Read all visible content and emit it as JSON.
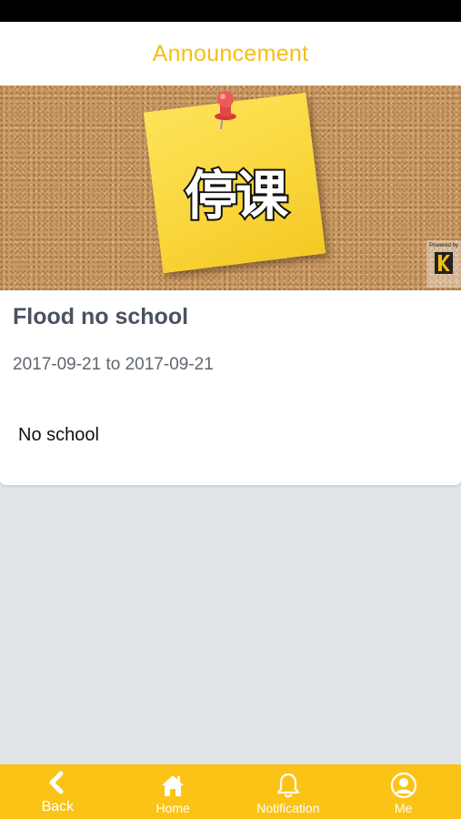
{
  "header": {
    "title": "Announcement"
  },
  "banner": {
    "note_text": "停课",
    "powered_by": "Powered by"
  },
  "announcement": {
    "title": "Flood no school",
    "date_range": "2017-09-21 to 2017-09-21",
    "body": "No school"
  },
  "tab_bar": {
    "items": [
      {
        "label": "Back",
        "icon": "chevron-left-icon"
      },
      {
        "label": "Home",
        "icon": "home-icon"
      },
      {
        "label": "Notification",
        "icon": "bell-icon"
      },
      {
        "label": "Me",
        "icon": "user-circle-icon"
      }
    ]
  },
  "colors": {
    "accent": "#f6bd16",
    "tab_bar_bg": "#fbc316",
    "page_bg": "#e1e5e8",
    "note": "#f9d53a"
  }
}
